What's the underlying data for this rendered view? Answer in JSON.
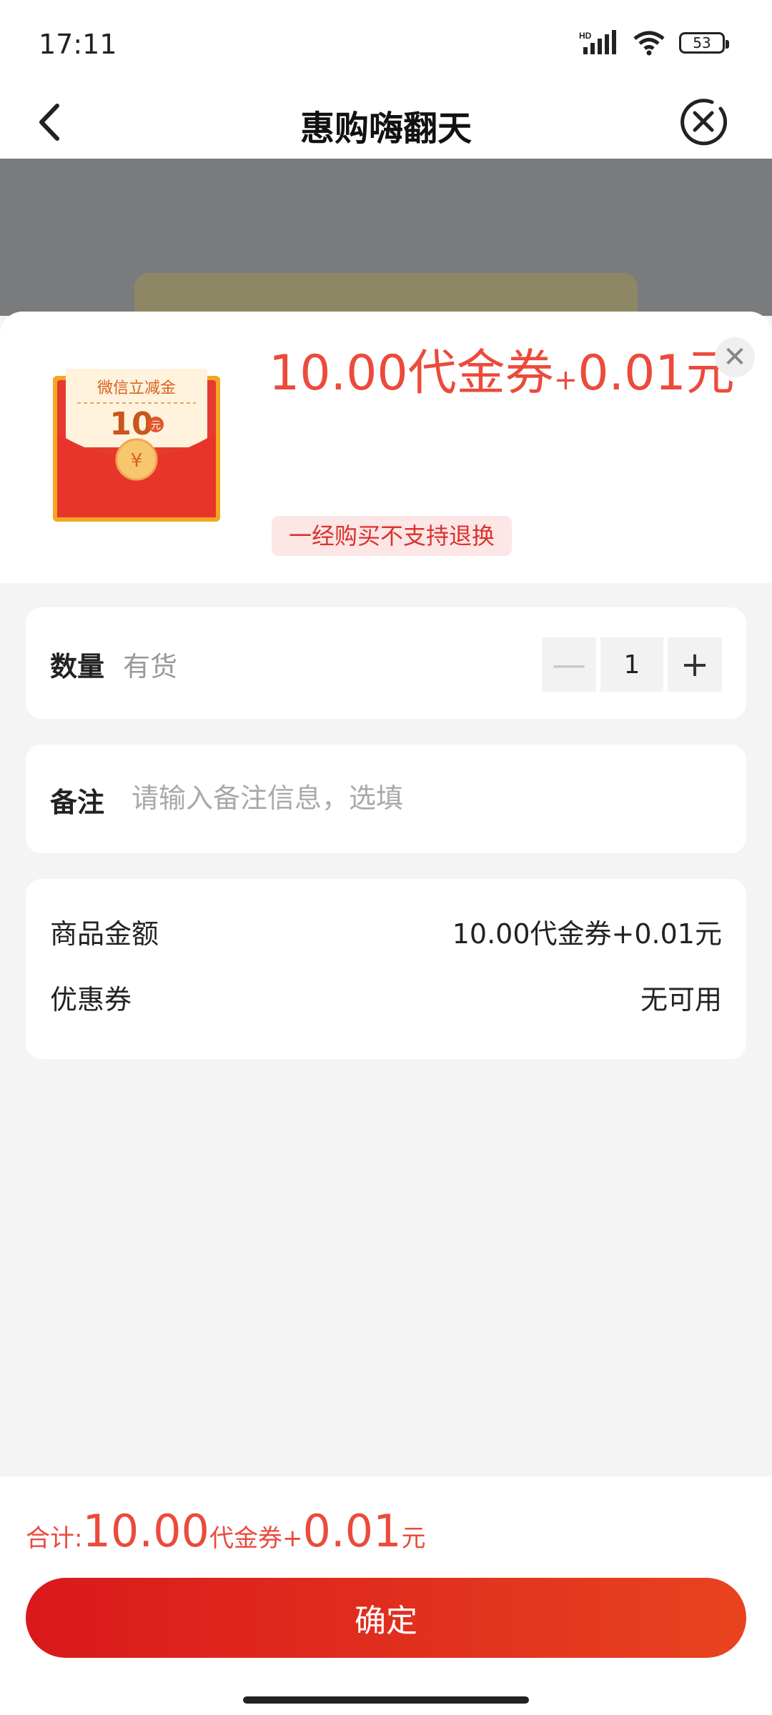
{
  "status_bar": {
    "time": "17:11",
    "network": "HD",
    "battery": "53"
  },
  "nav": {
    "title": "惠购嗨翻天"
  },
  "product": {
    "voucher_label": "微信立减金",
    "voucher_amount": "10",
    "voucher_unit": "元",
    "voucher_symbol": "¥",
    "price_part1": "10.00代金券",
    "price_plus": "+",
    "price_part2": "0.01元",
    "close_glyph": "✕",
    "tag": "一经购买不支持退换"
  },
  "quantity": {
    "label": "数量",
    "stock": "有货",
    "minus": "—",
    "value": "1",
    "plus": "+"
  },
  "note": {
    "label": "备注",
    "placeholder": "请输入备注信息，选填"
  },
  "summary": {
    "goods_label": "商品金额",
    "goods_value": "10.00代金券+0.01元",
    "coupon_label": "优惠券",
    "coupon_value": "无可用"
  },
  "footer": {
    "total_label": "合计:",
    "total_amount1": "10.00",
    "total_unit1": "代金券",
    "total_plus": "+",
    "total_amount2": "0.01",
    "total_unit2": "元",
    "confirm_label": "确定"
  },
  "colors": {
    "accent": "#ec4a3c",
    "button_start": "#d9191c",
    "button_end": "#e8431f",
    "tag_bg": "#fde6e6"
  }
}
